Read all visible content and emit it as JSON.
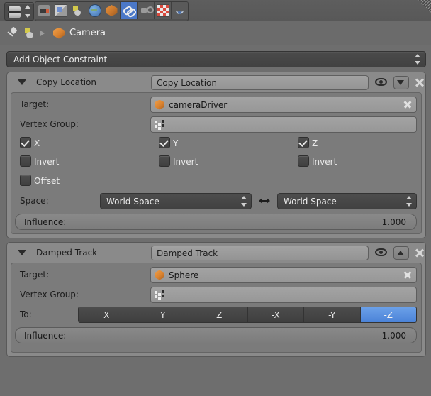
{
  "topbar": {
    "editor_selector": "editor-type-selector",
    "tabs": [
      {
        "name": "render",
        "icon": "camera-back-icon",
        "active": false
      },
      {
        "name": "render-layers",
        "icon": "images-icon",
        "active": false
      },
      {
        "name": "scene",
        "icon": "scene-icon",
        "active": false
      },
      {
        "name": "world",
        "icon": "world-globe-icon",
        "active": false
      },
      {
        "name": "object",
        "icon": "object-cube-icon",
        "active": false
      },
      {
        "name": "constraints",
        "icon": "chain-link-icon",
        "active": true
      },
      {
        "name": "physics",
        "icon": "physics-icon",
        "active": false
      },
      {
        "name": "texture",
        "icon": "checker-texture-icon",
        "active": false
      },
      {
        "name": "particles",
        "icon": "particles-icon",
        "active": false
      }
    ]
  },
  "breadcrumb": {
    "pin_icon": "pin-icon",
    "object_icon": "object-data-icon",
    "separator_icon": "chevron-right-icon",
    "item_icon": "object-cube-icon",
    "item_label": "Camera"
  },
  "add_constraint": {
    "label": "Add Object Constraint"
  },
  "constraints": [
    {
      "type_label": "Copy Location",
      "name_value": "Copy Location",
      "collapse_icon": "triangle-down-icon",
      "visibility_icon": "eye-icon",
      "move_icon": "move-down-icon",
      "delete_icon": "close-x-icon",
      "target_label": "Target:",
      "target_value": "cameraDriver",
      "target_icon": "object-cube-icon",
      "target_clear_icon": "clear-x-icon",
      "vertex_group_label": "Vertex Group:",
      "vertex_group_value": "",
      "vertex_group_icon": "vertex-group-icon",
      "axes": [
        {
          "label": "X",
          "checked": true,
          "invert_label": "Invert",
          "invert_checked": false
        },
        {
          "label": "Y",
          "checked": true,
          "invert_label": "Invert",
          "invert_checked": false
        },
        {
          "label": "Z",
          "checked": true,
          "invert_label": "Invert",
          "invert_checked": false
        }
      ],
      "offset_label": "Offset",
      "offset_checked": false,
      "space_label": "Space:",
      "space_owner": "World Space",
      "space_target": "World Space",
      "swap_icon": "swap-arrows-icon",
      "influence_label": "Influence:",
      "influence_value": "1.000"
    },
    {
      "type_label": "Damped Track",
      "name_value": "Damped Track",
      "collapse_icon": "triangle-down-icon",
      "visibility_icon": "eye-icon",
      "move_icon": "move-up-icon",
      "delete_icon": "close-x-icon",
      "target_label": "Target:",
      "target_value": "Sphere",
      "target_icon": "object-cube-icon",
      "target_clear_icon": "clear-x-icon",
      "vertex_group_label": "Vertex Group:",
      "vertex_group_value": "",
      "vertex_group_icon": "vertex-group-icon",
      "to_label": "To:",
      "to_options": [
        "X",
        "Y",
        "Z",
        "-X",
        "-Y",
        "-Z"
      ],
      "to_selected": "-Z",
      "influence_label": "Influence:",
      "influence_value": "1.000"
    }
  ],
  "colors": {
    "background": "#6e6e6e",
    "panel": "#8a8a8a",
    "panel_body": "#7b7b7b",
    "accent_blue": "#4b83d8",
    "object_orange": "#d9822f",
    "field": "#9d9d9d",
    "dropdown": "#464646"
  }
}
